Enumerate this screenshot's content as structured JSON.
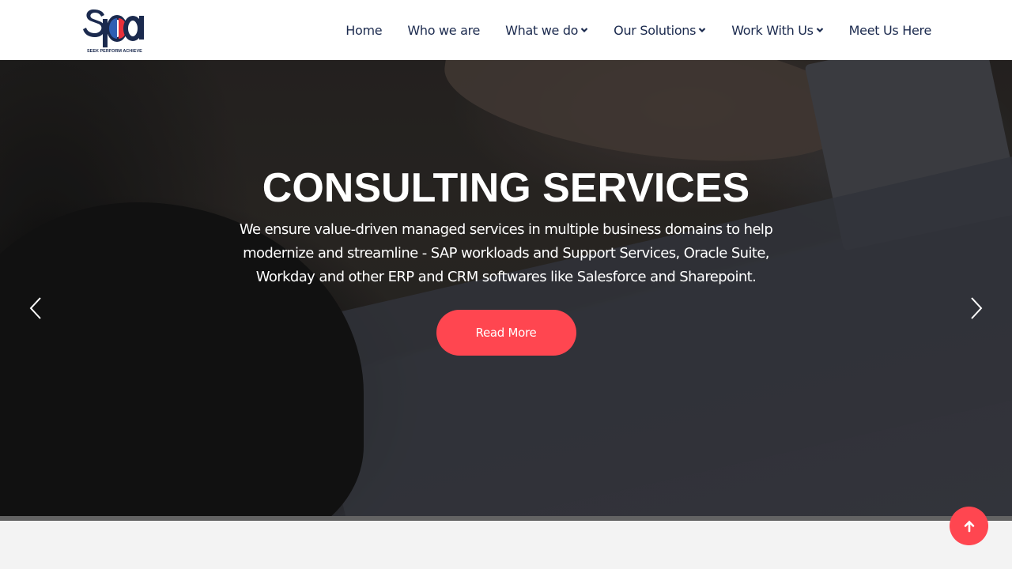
{
  "brand": {
    "logo_letters": "spa",
    "tagline": "SEEK PERFORM ACHIEVE",
    "colors": {
      "navy": "#1b2a4e",
      "blue": "#2f5fb3",
      "red": "#e8303a"
    }
  },
  "nav": {
    "items": [
      {
        "label": "Home",
        "has_dropdown": false
      },
      {
        "label": "Who we are",
        "has_dropdown": false
      },
      {
        "label": "What we do",
        "has_dropdown": true
      },
      {
        "label": "Our Solutions",
        "has_dropdown": true
      },
      {
        "label": "Work With Us",
        "has_dropdown": true
      },
      {
        "label": "Meet Us Here",
        "has_dropdown": false
      }
    ]
  },
  "hero": {
    "title": "CONSULTING SERVICES",
    "text": "We ensure value-driven managed services in multiple business domains to help modernize and streamline - SAP workloads and Support Services, Oracle Suite, Workday and other ERP and CRM softwares like Salesforce and Sharepoint.",
    "cta_label": "Read More",
    "prev_icon": "chevron-left-icon",
    "next_icon": "chevron-right-icon"
  },
  "scroll_top": {
    "icon": "arrow-up-icon"
  },
  "colors": {
    "accent": "#ff4650",
    "nav_text": "#1b2a4e",
    "section_bg": "#f3f3f3"
  }
}
